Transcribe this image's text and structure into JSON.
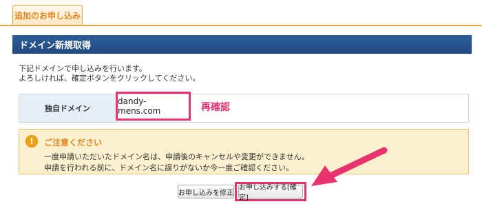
{
  "tabs": [
    {
      "label": "追加のお申し込み",
      "active": true
    }
  ],
  "section": {
    "title": "ドメイン新規取得"
  },
  "description": {
    "line1": "下記ドメインで申し込みを行います。",
    "line2": "よろしければ、確定ボタンをクリックしてください。"
  },
  "domain": {
    "label": "独自ドメイン",
    "value": "dandy-mens.com",
    "annotation": "再確認"
  },
  "notice": {
    "icon": "exclamation-icon",
    "title": "ご注意ください",
    "line1": "一度申請いただいたドメイン名は、申請後のキャンセルや変更ができません。",
    "line2": "申請を行われる前に、ドメイン名に誤りがないか今一度ご確認ください。"
  },
  "buttons": {
    "modify": "お申し込みを修正",
    "confirm": "お申し込みする[確定]"
  },
  "colors": {
    "accent_orange": "#e9a23b",
    "header_blue": "#2c5d9b",
    "highlight_pink": "#e8336e",
    "notice_bg": "#fcf0cf"
  }
}
